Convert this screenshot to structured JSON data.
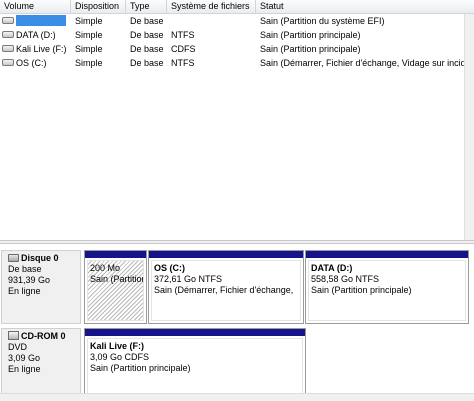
{
  "volume_list": {
    "columns": [
      "Volume",
      "Disposition",
      "Type",
      "Système de fichiers",
      "Statut"
    ],
    "rows": [
      {
        "name": "",
        "selected": true,
        "layout": "Simple",
        "type": "De base",
        "fs": "",
        "status": "Sain (Partition du système EFI)"
      },
      {
        "name": "DATA (D:)",
        "layout": "Simple",
        "type": "De base",
        "fs": "NTFS",
        "status": "Sain (Partition principale)"
      },
      {
        "name": "Kali Live (F:)",
        "layout": "Simple",
        "type": "De base",
        "fs": "CDFS",
        "status": "Sain (Partition principale)"
      },
      {
        "name": "OS (C:)",
        "layout": "Simple",
        "type": "De base",
        "fs": "NTFS",
        "status": "Sain (Démarrer, Fichier d'échange, Vidage sur incid"
      }
    ]
  },
  "disks": [
    {
      "title": "Disque 0",
      "kind": "De base",
      "size": "931,39 Go",
      "state": "En ligne",
      "partitions": [
        {
          "name": "",
          "size": "200 Mo",
          "status": "Sain (Partition",
          "hatched": true
        },
        {
          "name": "OS  (C:)",
          "size": "372,61 Go NTFS",
          "status": "Sain (Démarrer, Fichier d'échange,"
        },
        {
          "name": "DATA  (D:)",
          "size": "558,58 Go NTFS",
          "status": "Sain (Partition principale)"
        }
      ]
    },
    {
      "title": "CD-ROM 0",
      "kind": "DVD",
      "size": "3,09 Go",
      "state": "En ligne",
      "partitions": [
        {
          "name": "Kali Live  (F:)",
          "size": "3,09 Go CDFS",
          "status": "Sain (Partition principale)"
        }
      ]
    }
  ],
  "icons": {
    "volume": "volume-icon",
    "disk": "hard-disk-icon",
    "cdrom": "cdrom-icon"
  },
  "colors": {
    "partition_bar": "#15148a",
    "selection": "#3a8ee6"
  }
}
